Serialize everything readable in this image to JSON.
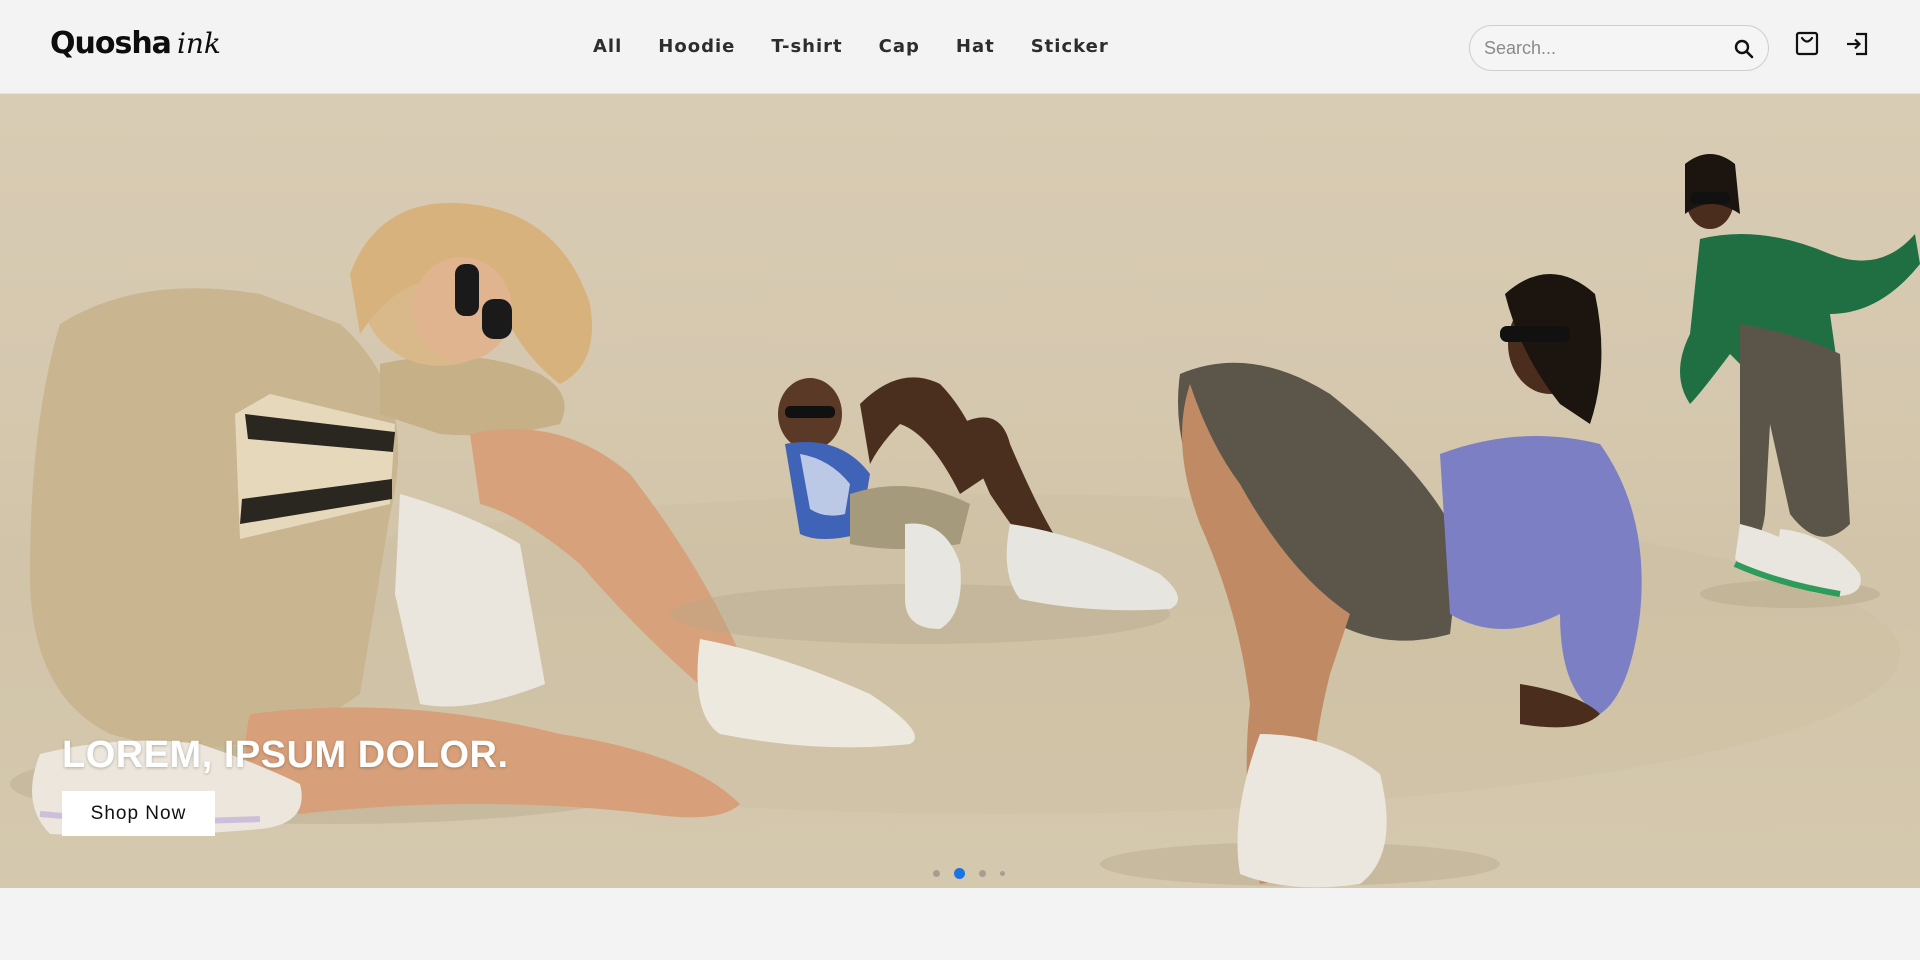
{
  "brand": {
    "logo_main": "Quosha",
    "logo_script": "ink"
  },
  "nav": {
    "items": [
      "All",
      "Hoodie",
      "T-shirt",
      "Cap",
      "Hat",
      "Sticker"
    ]
  },
  "search": {
    "placeholder": "Search...",
    "value": ""
  },
  "header_icons": {
    "cart": "shopping-bag-icon",
    "login": "login-icon"
  },
  "hero": {
    "title": "LOREM, IPSUM DOLOR.",
    "cta_label": "Shop Now",
    "slides_count": 4,
    "active_slide": 2
  },
  "colors": {
    "page_bg": "#f3f3f3",
    "hero_bg": "#d6c9b0",
    "accent_dot": "#1b74e4",
    "cta_bg": "#ffffff"
  }
}
